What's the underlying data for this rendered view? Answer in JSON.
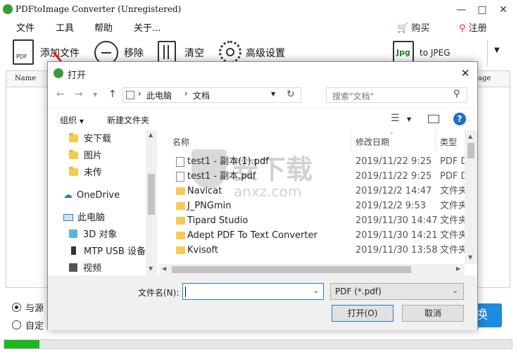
{
  "app": {
    "title": "PDFtoImage Converter (Unregistered)",
    "menu": [
      "文件",
      "工具",
      "帮助",
      "关于..."
    ],
    "buy_label": "购买",
    "register_label": "注册",
    "toolbar": {
      "add_file": "添加文件",
      "remove": "移除",
      "clear": "清空",
      "advanced": "高级设置",
      "format_label": "to JPEG",
      "format_icon_text": "Jpg",
      "pdf_icon_text": "PDF"
    },
    "grid": {
      "col_name": "Name",
      "col_right": "age"
    },
    "options": [
      "与源",
      "自定"
    ],
    "convert_label": "换",
    "progress": 0.07
  },
  "dialog": {
    "title": "打开",
    "address": [
      "此电脑",
      "文档"
    ],
    "search_placeholder": "搜索\"文档\"",
    "organize": "组织",
    "new_folder": "新建文件夹",
    "nav_items": [
      {
        "label": "安下载",
        "type": "folder"
      },
      {
        "label": "图片",
        "type": "folder"
      },
      {
        "label": "未传",
        "type": "folder"
      },
      {
        "label": "OneDrive",
        "type": "cloud"
      },
      {
        "label": "此电脑",
        "type": "pc"
      },
      {
        "label": "3D 对象",
        "type": "3d"
      },
      {
        "label": "MTP USB 设备",
        "type": "usb"
      },
      {
        "label": "视频",
        "type": "video"
      }
    ],
    "columns": {
      "name": "名称",
      "date": "修改日期",
      "type": "类型"
    },
    "files": [
      {
        "name": "test1 - 副本(1).pdf",
        "date": "2019/11/22 9:25",
        "type": "PDF D",
        "kind": "file"
      },
      {
        "name": "test1 - 副本.pdf",
        "date": "2019/11/22 9:25",
        "type": "PDF D",
        "kind": "file"
      },
      {
        "name": "Navicat",
        "date": "2019/12/2 14:47",
        "type": "文件夹",
        "kind": "dir"
      },
      {
        "name": "J_PNGmin",
        "date": "2019/12/2 9:53",
        "type": "文件夹",
        "kind": "dir"
      },
      {
        "name": "Tipard Studio",
        "date": "2019/11/30 14:47",
        "type": "文件夹",
        "kind": "dir"
      },
      {
        "name": "Adept PDF To Text Converter",
        "date": "2019/11/30 14:21",
        "type": "文件夹",
        "kind": "dir"
      },
      {
        "name": "Kvisoft",
        "date": "2019/11/30 13:58",
        "type": "文件夹",
        "kind": "dir"
      }
    ],
    "filename_label": "文件名(N):",
    "filename_value": "",
    "filter_value": "PDF (*.pdf)",
    "open_label": "打开(O)",
    "cancel_label": "取消"
  },
  "watermark": {
    "text1": "安下载",
    "text2": "anxz.com"
  }
}
